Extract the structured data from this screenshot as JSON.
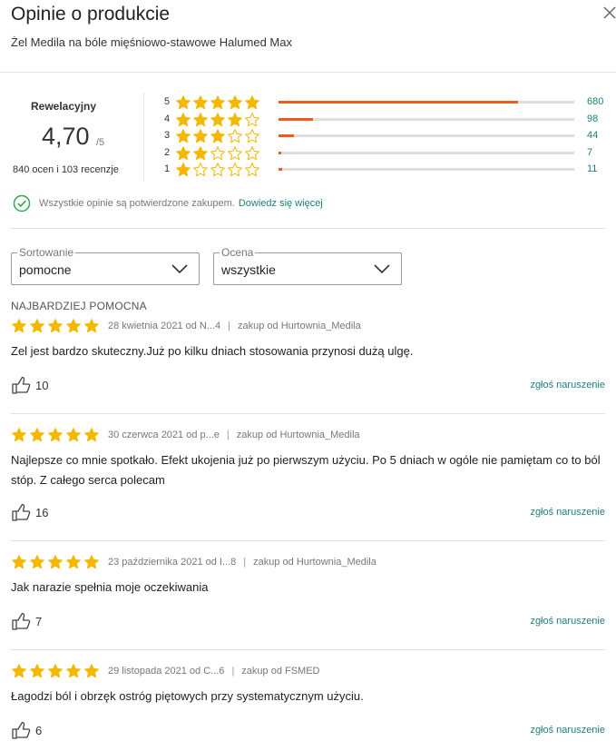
{
  "header": {
    "title": "Opinie o produkcie",
    "subtitle": "Żel Medila na bóle mięśniowo-stawowe Halumed Max"
  },
  "summary": {
    "label": "Rewelacyjny",
    "rating": "4,70",
    "rating_max": "/5",
    "counts": "840 ocen i 103 recenzje",
    "distribution": [
      {
        "stars": "5",
        "count": "680",
        "fraction": 0.8095,
        "filled": 5
      },
      {
        "stars": "4",
        "count": "98",
        "fraction": 0.1167,
        "filled": 4
      },
      {
        "stars": "3",
        "count": "44",
        "fraction": 0.0524,
        "filled": 3
      },
      {
        "stars": "2",
        "count": "7",
        "fraction": 0.0083,
        "filled": 2
      },
      {
        "stars": "1",
        "count": "11",
        "fraction": 0.0131,
        "filled": 1
      }
    ]
  },
  "verified": {
    "text": "Wszystkie opinie są potwierdzone zakupem.",
    "link": "Dowiedz się więcej"
  },
  "filters": {
    "sort_label": "Sortowanie",
    "sort_value": "pomocne",
    "rating_label": "Ocena",
    "rating_value": "wszystkie"
  },
  "section_title": "NAJBARDZIEJ POMOCNA",
  "reviews": [
    {
      "rating": 5,
      "date": "28 kwietnia 2021 od N...4",
      "source": "zakup od Hurtownia_Medila",
      "text": "Zel jest bardzo skuteczny.Już po kilku dniach stosowania przynosi dużą ulgę.",
      "likes": "10",
      "report": "zgłoś naruszenie"
    },
    {
      "rating": 5,
      "date": "30 czerwca 2021 od p...e",
      "source": "zakup od Hurtownia_Medila",
      "text": "Najlepsze co mnie spotkało. Efekt ukojenia już po pierwszym użyciu. Po 5 dniach w ogóle nie pamiętam co to ból stóp. Z całego serca polecam",
      "likes": "16",
      "report": "zgłoś naruszenie"
    },
    {
      "rating": 5,
      "date": "23 października 2021 od I...8",
      "source": "zakup od Hurtownia_Medila",
      "text": "Jak narazie spełnia moje oczekiwania",
      "likes": "7",
      "report": "zgłoś naruszenie"
    },
    {
      "rating": 5,
      "date": "29 listopada 2021 od C...6",
      "source": "zakup od FSMED",
      "text": "Łagodzi ból i obrzęk ostróg piętowych przy systematycznym użyciu.",
      "likes": "6",
      "report": "zgłoś naruszenie"
    }
  ],
  "colors": {
    "accent_orange": "#f05a1a",
    "star": "#f5b800",
    "link_teal": "#1a7f7a",
    "check_green": "#2eaa4a"
  },
  "icons": {
    "close": "close-icon",
    "star": "star-icon",
    "check": "check-circle-icon",
    "chevron": "chevron-down-icon",
    "thumb": "thumb-up-icon"
  }
}
